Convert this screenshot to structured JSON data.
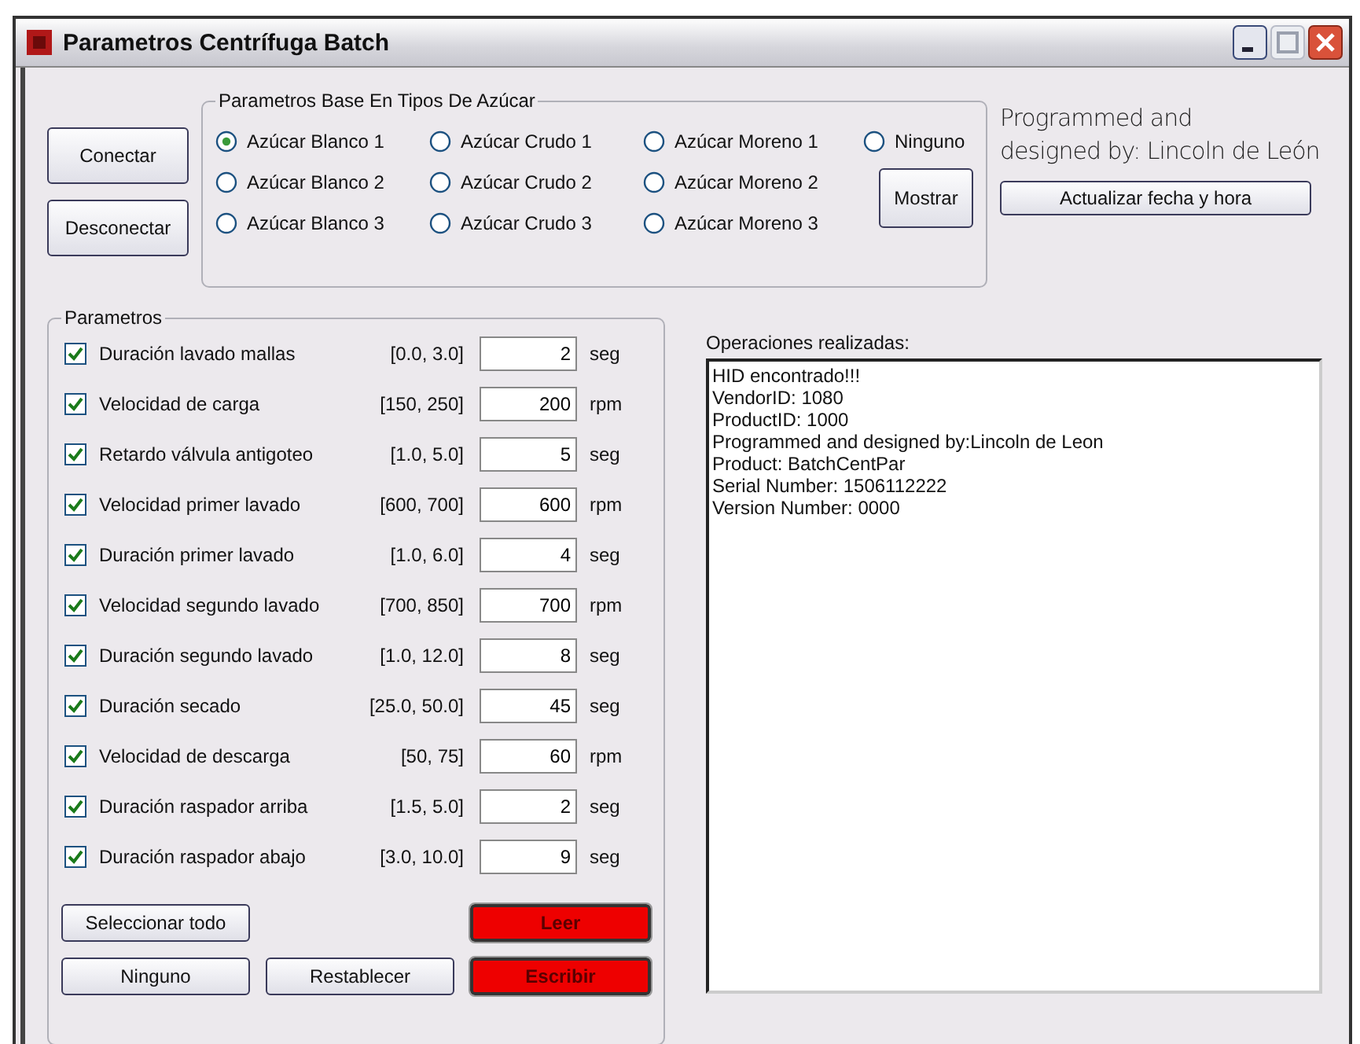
{
  "window": {
    "title": "Parametros Centrífuga Batch"
  },
  "connection_buttons": [
    "Conectar",
    "Desconectar"
  ],
  "sugar_types": {
    "title": "Parametros Base  En Tipos De Azúcar",
    "options": [
      {
        "label": "Azúcar Blanco 1",
        "selected": true
      },
      {
        "label": "Azúcar Crudo 1",
        "selected": false
      },
      {
        "label": "Azúcar Moreno 1",
        "selected": false
      },
      {
        "label": "Ninguno",
        "selected": false
      },
      {
        "label": "Azúcar Blanco 2",
        "selected": false
      },
      {
        "label": "Azúcar Crudo 2",
        "selected": false
      },
      {
        "label": "Azúcar Moreno 2",
        "selected": false
      },
      {
        "label": "Azúcar Blanco 3",
        "selected": false
      },
      {
        "label": "Azúcar Crudo 3",
        "selected": false
      },
      {
        "label": "Azúcar Moreno 3",
        "selected": false
      }
    ],
    "button": "Mostrar"
  },
  "author_note": [
    "Programmed and",
    "designed by: Lincoln de León"
  ],
  "update_button": "Actualizar fecha y hora",
  "parameters": {
    "title": "Parametros",
    "rows": [
      {
        "label": "Duración lavado mallas",
        "range": "[0.0, 3.0]",
        "value": "2",
        "unit": "seg",
        "checked": true
      },
      {
        "label": "Velocidad de carga",
        "range": "[150, 250]",
        "value": "200",
        "unit": "rpm",
        "checked": true
      },
      {
        "label": "Retardo válvula antigoteo",
        "range": "[1.0, 5.0]",
        "value": "5",
        "unit": "seg",
        "checked": true
      },
      {
        "label": "Velocidad primer lavado",
        "range": "[600, 700]",
        "value": "600",
        "unit": "rpm",
        "checked": true
      },
      {
        "label": "Duración primer lavado",
        "range": "[1.0, 6.0]",
        "value": "4",
        "unit": "seg",
        "checked": true
      },
      {
        "label": "Velocidad segundo lavado",
        "range": "[700, 850]",
        "value": "700",
        "unit": "rpm",
        "checked": true
      },
      {
        "label": "Duración segundo lavado",
        "range": "[1.0, 12.0]",
        "value": "8",
        "unit": "seg",
        "checked": true
      },
      {
        "label": "Duración secado",
        "range": "[25.0, 50.0]",
        "value": "45",
        "unit": "seg",
        "checked": true
      },
      {
        "label": "Velocidad de descarga",
        "range": "[50, 75]",
        "value": "60",
        "unit": "rpm",
        "checked": true
      },
      {
        "label": "Duración raspador arriba",
        "range": "[1.5, 5.0]",
        "value": "2",
        "unit": "seg",
        "checked": true
      },
      {
        "label": "Duración raspador abajo",
        "range": "[3.0, 10.0]",
        "value": "9",
        "unit": "seg",
        "checked": true
      }
    ],
    "buttons": [
      {
        "label": "Seleccionar todo",
        "kind": "plain"
      },
      {
        "label": "Leer",
        "kind": "alert"
      },
      {
        "label": "Ninguno",
        "kind": "plain"
      },
      {
        "label": "Restablecer",
        "kind": "plain"
      },
      {
        "label": "Escribir",
        "kind": "alert"
      }
    ]
  },
  "log": {
    "label": "Operaciones realizadas:",
    "lines": [
      "HID encontrado!!!",
      "VendorID: 1080",
      "ProductID: 1000",
      "Programmed and designed by:Lincoln de Leon",
      "Product: BatchCentPar",
      "Serial Number: 1506112222",
      "Version Number: 0000"
    ]
  }
}
